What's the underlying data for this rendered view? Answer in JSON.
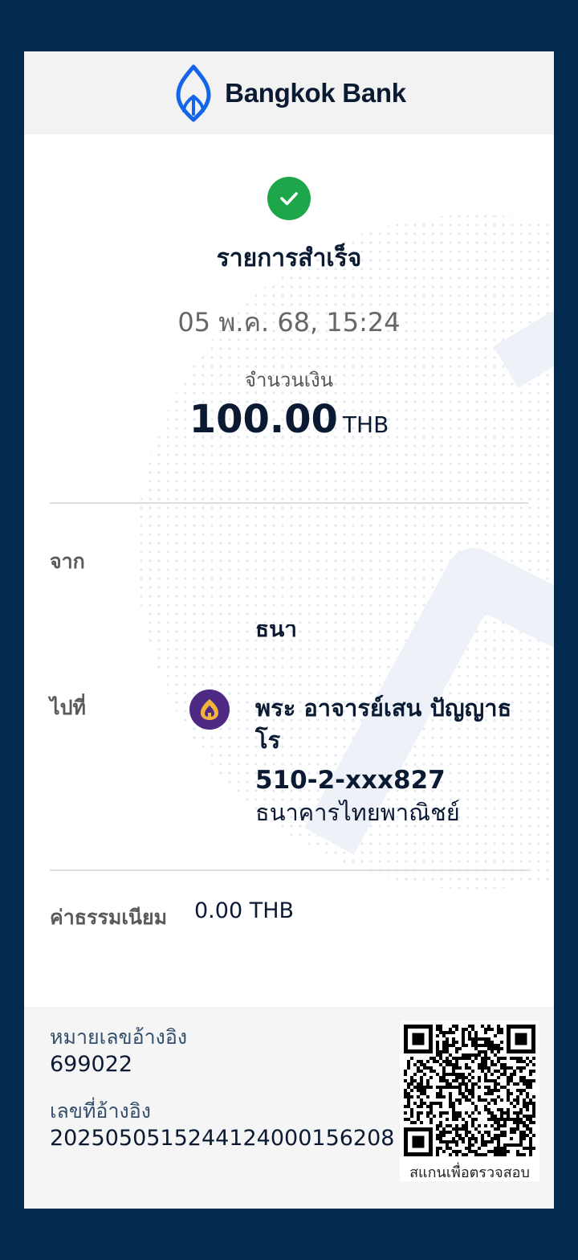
{
  "header": {
    "brand": "Bangkok Bank",
    "logo_icon": "bangkok-bank-lotus-logo"
  },
  "status": {
    "icon": "check-circle-icon",
    "text": "รายการสำเร็จ",
    "color": "#1ea64a"
  },
  "datetime": "05 พ.ค. 68, 15:24",
  "amount": {
    "label": "จำนวนเงิน",
    "value": "100.00",
    "currency": "THB"
  },
  "from": {
    "label": "จาก"
  },
  "to": {
    "label": "ไปที่",
    "bank_icon": "siam-commercial-bank-icon",
    "name": "พระ อาจารย์เสน ปัญญาธโร",
    "account": "510-2-xxx827",
    "bank": "ธนาคารไทยพาณิชย์"
  },
  "fee": {
    "label": "ค่าธรรมเนียม",
    "value": "0.00 THB"
  },
  "references": [
    {
      "label": "หมายเลขอ้างอิง",
      "value": "699022"
    },
    {
      "label": "เลขที่อ้างอิง",
      "value": "2025050515244124000156208"
    }
  ],
  "qr": {
    "icon": "qr-code-icon",
    "caption": "สแกนเพื่อตรวจสอบ"
  },
  "colors": {
    "background": "#03294f",
    "brand_blue": "#1565e8",
    "text_dark": "#0b1a33"
  }
}
